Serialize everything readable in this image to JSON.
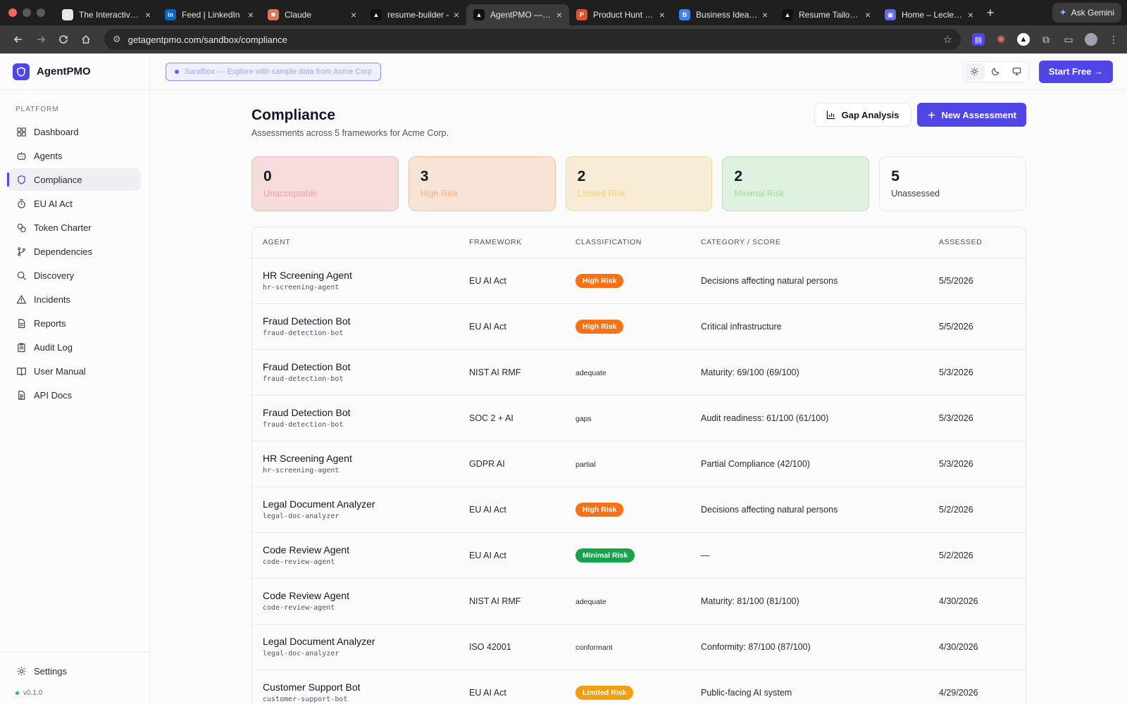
{
  "browser": {
    "tabs": [
      {
        "title": "The Interactive P",
        "icon": "circle-icon",
        "color": "#e5e7eb",
        "active": false
      },
      {
        "title": "Feed | LinkedIn",
        "icon": "linkedin-icon",
        "color": "#0a66c2",
        "active": false
      },
      {
        "title": "Claude",
        "icon": "claude-icon",
        "color": "#d97757",
        "active": false
      },
      {
        "title": "resume-builder -",
        "icon": "triangle-icon",
        "color": "#111111",
        "active": false
      },
      {
        "title": "AgentPMO — AI",
        "icon": "triangle-icon",
        "color": "#111111",
        "active": true
      },
      {
        "title": "Product Hunt – T",
        "icon": "producthunt-icon",
        "color": "#da552f",
        "active": false
      },
      {
        "title": "Business Idea Va",
        "icon": "b-icon",
        "color": "#3b82f6",
        "active": false
      },
      {
        "title": "Resume Tailor —",
        "icon": "triangle-icon",
        "color": "#111111",
        "active": false
      },
      {
        "title": "Home – Leclezio",
        "icon": "chat-icon",
        "color": "#6366f1",
        "active": false
      }
    ],
    "ask_gemini": "Ask Gemini",
    "url": "getagentpmo.com/sandbox/compliance"
  },
  "app": {
    "brand": "AgentPMO",
    "section_label": "PLATFORM",
    "nav": [
      {
        "label": "Dashboard",
        "icon": "grid-icon",
        "active": false
      },
      {
        "label": "Agents",
        "icon": "bot-icon",
        "active": false
      },
      {
        "label": "Compliance",
        "icon": "shield-icon",
        "active": true
      },
      {
        "label": "EU AI Act",
        "icon": "timer-icon",
        "active": false
      },
      {
        "label": "Token Charter",
        "icon": "coins-icon",
        "active": false
      },
      {
        "label": "Dependencies",
        "icon": "branch-icon",
        "active": false
      },
      {
        "label": "Discovery",
        "icon": "search-icon",
        "active": false
      },
      {
        "label": "Incidents",
        "icon": "warning-icon",
        "active": false
      },
      {
        "label": "Reports",
        "icon": "file-icon",
        "active": false
      },
      {
        "label": "Audit Log",
        "icon": "clipboard-icon",
        "active": false
      },
      {
        "label": "User Manual",
        "icon": "book-icon",
        "active": false
      },
      {
        "label": "API Docs",
        "icon": "doc-icon",
        "active": false
      }
    ],
    "settings_label": "Settings",
    "version": "v0.1.0",
    "sandbox_text": "Sandbox — Explore with sample data from Acme Corp",
    "start_free": "Start Free →"
  },
  "page": {
    "title": "Compliance",
    "subtitle": "Assessments across 5 frameworks for Acme Corp.",
    "gap_analysis": "Gap Analysis",
    "new_assessment": "New Assessment"
  },
  "stats": [
    {
      "value": "0",
      "label": "Unacceptable",
      "kind": "unacc"
    },
    {
      "value": "3",
      "label": "High Risk",
      "kind": "high"
    },
    {
      "value": "2",
      "label": "Limited Risk",
      "kind": "limited"
    },
    {
      "value": "2",
      "label": "Minimal Risk",
      "kind": "minimal"
    },
    {
      "value": "5",
      "label": "Unassessed",
      "kind": "unass"
    }
  ],
  "table": {
    "columns": [
      "AGENT",
      "FRAMEWORK",
      "CLASSIFICATION",
      "CATEGORY / SCORE",
      "ASSESSED"
    ],
    "rows": [
      {
        "agent": "HR Screening Agent",
        "slug": "hr-screening-agent",
        "framework": "EU AI Act",
        "classification": "High Risk",
        "badge": "high",
        "category": "Decisions affecting natural persons",
        "assessed": "5/5/2026"
      },
      {
        "agent": "Fraud Detection Bot",
        "slug": "fraud-detection-bot",
        "framework": "EU AI Act",
        "classification": "High Risk",
        "badge": "high",
        "category": "Critical infrastructure",
        "assessed": "5/5/2026"
      },
      {
        "agent": "Fraud Detection Bot",
        "slug": "fraud-detection-bot",
        "framework": "NIST AI RMF",
        "classification": "adequate",
        "badge": "",
        "category": "Maturity: 69/100 (69/100)",
        "assessed": "5/3/2026"
      },
      {
        "agent": "Fraud Detection Bot",
        "slug": "fraud-detection-bot",
        "framework": "SOC 2 + AI",
        "classification": "gaps",
        "badge": "",
        "category": "Audit readiness: 61/100 (61/100)",
        "assessed": "5/3/2026"
      },
      {
        "agent": "HR Screening Agent",
        "slug": "hr-screening-agent",
        "framework": "GDPR AI",
        "classification": "partial",
        "badge": "",
        "category": "Partial Compliance (42/100)",
        "assessed": "5/3/2026"
      },
      {
        "agent": "Legal Document Analyzer",
        "slug": "legal-doc-analyzer",
        "framework": "EU AI Act",
        "classification": "High Risk",
        "badge": "high",
        "category": "Decisions affecting natural persons",
        "assessed": "5/2/2026"
      },
      {
        "agent": "Code Review Agent",
        "slug": "code-review-agent",
        "framework": "EU AI Act",
        "classification": "Minimal Risk",
        "badge": "minimal",
        "category": "—",
        "assessed": "5/2/2026"
      },
      {
        "agent": "Code Review Agent",
        "slug": "code-review-agent",
        "framework": "NIST AI RMF",
        "classification": "adequate",
        "badge": "",
        "category": "Maturity: 81/100 (81/100)",
        "assessed": "4/30/2026"
      },
      {
        "agent": "Legal Document Analyzer",
        "slug": "legal-doc-analyzer",
        "framework": "ISO 42001",
        "classification": "conformant",
        "badge": "",
        "category": "Conformity: 87/100 (87/100)",
        "assessed": "4/30/2026"
      },
      {
        "agent": "Customer Support Bot",
        "slug": "customer-support-bot",
        "framework": "EU AI Act",
        "classification": "Limited Risk",
        "badge": "limited",
        "category": "Public-facing AI system",
        "assessed": "4/29/2026"
      }
    ]
  }
}
